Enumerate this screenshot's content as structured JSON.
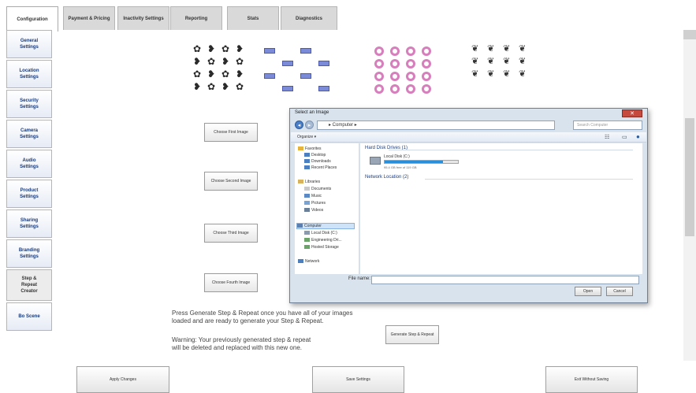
{
  "tabs": [
    {
      "label": "Configuration"
    },
    {
      "label": "Payment & Pricing"
    },
    {
      "label": "Inactivity Settings"
    },
    {
      "label": "Reporting"
    },
    {
      "label": "Stats"
    },
    {
      "label": "Diagnostics"
    }
  ],
  "nav": [
    {
      "label": "General\nSettings"
    },
    {
      "label": "Location\nSettings"
    },
    {
      "label": "Security\nSettings"
    },
    {
      "label": "Camera\nSettings"
    },
    {
      "label": "Audio\nSettings"
    },
    {
      "label": "Product\nSettings"
    },
    {
      "label": "Sharing\nSettings"
    },
    {
      "label": "Branding\nSettings"
    },
    {
      "label": "Step &\nRepeat\nCreator"
    },
    {
      "label": "Bo Scene"
    }
  ],
  "image_buttons": [
    {
      "label": "Choose First Image"
    },
    {
      "label": "Choose Second Image"
    },
    {
      "label": "Choose Third Image"
    },
    {
      "label": "Choose Fourth Image"
    }
  ],
  "instructions": {
    "line1": "Press Generate Step & Repeat once you have all of your images",
    "line2": "loaded and are ready to generate your Step & Repeat.",
    "warning1": "Warning: Your previously generated step & repeat",
    "warning2": "will be deleted and replaced with this new one."
  },
  "generate_button": "Generate Step & Repeat",
  "dialog": {
    "title": "Select an Image",
    "close_glyph": "✕",
    "address": "▸ Computer ▸",
    "search_placeholder": "Search Computer",
    "organize": "Organize ▾",
    "tree": [
      "Favorites",
      "Desktop",
      "Downloads",
      "Recent Places",
      "Libraries",
      "Documents",
      "Music",
      "Pictures",
      "Videos",
      "Computer",
      "Local Disk (C:)",
      "Engineering Dri...",
      "Hosted Storage",
      "Network"
    ],
    "section_drives": "Hard Disk Drives (1)",
    "drive_name": "Local Disk (C:)",
    "drive_free": "95.4 GB free of 119 GB",
    "drive_fill": 0.8,
    "section_network": "Network Location (2)",
    "filename_label": "File name:",
    "open": "Open",
    "cancel": "Cancel"
  },
  "bottom_buttons": [
    {
      "label": "Apply Changes"
    },
    {
      "label": "Save Settings"
    },
    {
      "label": "Exit Without Saving"
    }
  ],
  "glyphs": {
    "figure": "✿",
    "heart": "❥",
    "ring": "ring",
    "leaf": "❦"
  },
  "colors": {
    "accent": "#1a3a78",
    "swatch": "#7b8bd8",
    "ring": "#d77fbc",
    "dialog_close": "#c74a3e"
  }
}
